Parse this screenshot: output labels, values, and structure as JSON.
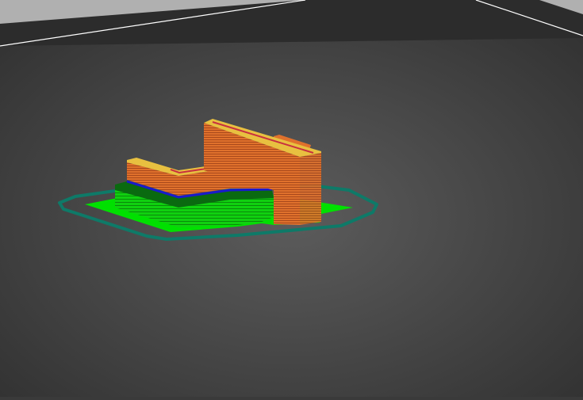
{
  "viewport": {
    "kind": "3d-gcode-preview",
    "colors": {
      "background_center": "#5c5c5c",
      "background_edge": "#2e2e2e",
      "bed_outline": "#ffffff",
      "skirt": "#0e7a68",
      "support": "#00e000",
      "support_interface": "#0a6a10",
      "bridge_infill": "#1a1acc",
      "perimeter": "#e0712c",
      "top_solid_infill": "#e8c040",
      "solid_infill": "#c83040"
    }
  }
}
